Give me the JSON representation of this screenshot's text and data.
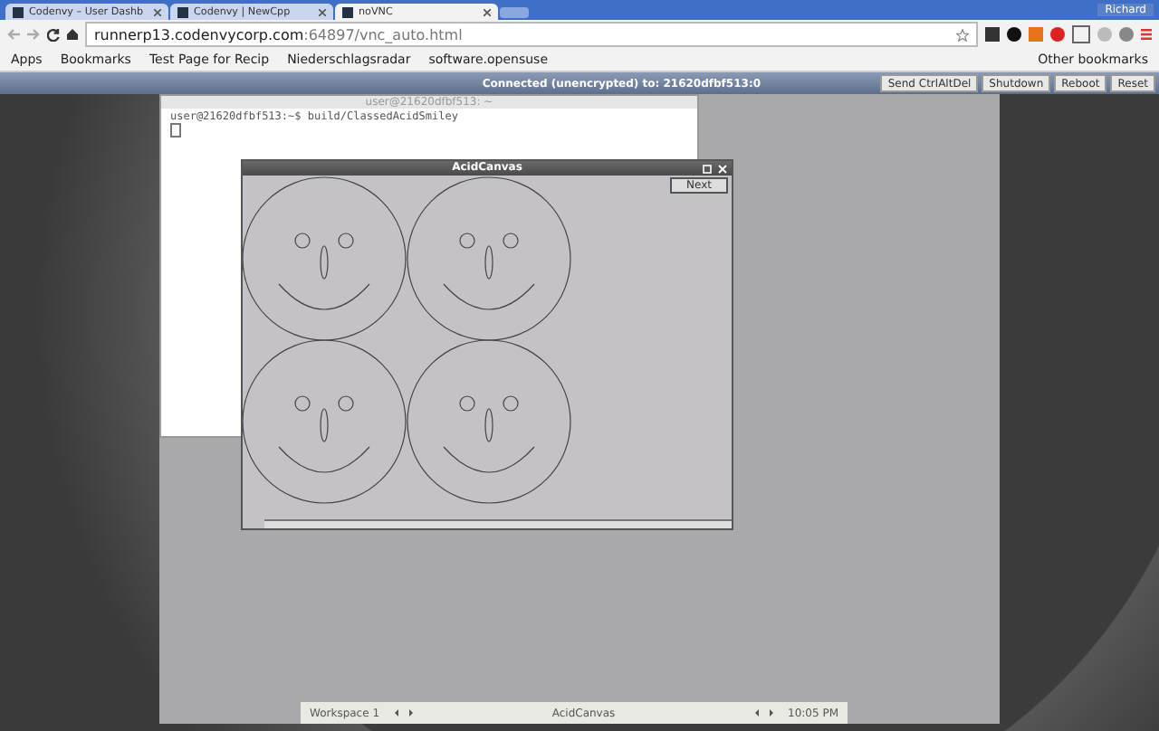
{
  "browser": {
    "tabs": [
      {
        "title": "Codenvy – User Dashb",
        "selected": false
      },
      {
        "title": "Codenvy | NewCpp",
        "selected": false
      },
      {
        "title": "noVNC",
        "selected": true
      }
    ],
    "user": "Richard",
    "url_host": "runnerp13.codenvycorp.com",
    "url_path": ":64897/vnc_auto.html",
    "bookmarks": [
      "Apps",
      "Bookmarks",
      "Test Page for Recip",
      "Niederschlagsradar",
      "software.opensuse"
    ],
    "other_bookmarks": "Other bookmarks"
  },
  "vnc": {
    "status": "Connected (unencrypted) to: 21620dfbf513:0",
    "buttons": [
      "Send CtrlAltDel",
      "Shutdown",
      "Reboot",
      "Reset"
    ]
  },
  "terminal": {
    "title": "user@21620dfbf513: ~",
    "lines": [
      "user@21620dfbf513:~$ build/ClassedAcidSmiley"
    ]
  },
  "canvas_window": {
    "title": "AcidCanvas",
    "button": "Next"
  },
  "taskbar": {
    "workspace": "Workspace 1",
    "window": "AcidCanvas",
    "clock": "10:05 PM"
  }
}
